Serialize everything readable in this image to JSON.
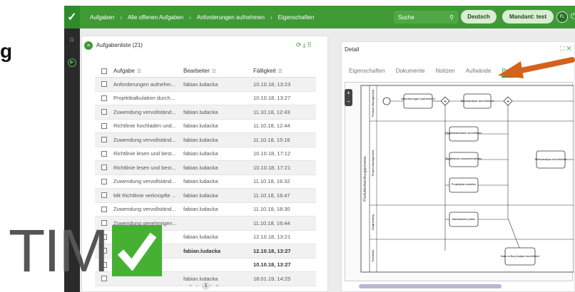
{
  "slide_text": "g",
  "topbar": {
    "breadcrumbs": [
      "Aufgaben",
      "Alle offenen Aufgaben",
      "Anforderungen aufnehmen",
      "Eigenschaften"
    ],
    "search_placeholder": "Suche",
    "language": "Deutsch",
    "mandant": "Mandant: test",
    "avatar_initials": "FL"
  },
  "tasklist": {
    "title": "Aufgabenliste (21)",
    "columns": [
      "Aufgabe",
      "Bearbeiter",
      "Fälligkeit"
    ],
    "rows": [
      {
        "task": "Anforderungen aufnehm...",
        "user": "fabian.ludacka",
        "due": "10.10.18, 13:23",
        "bold": false
      },
      {
        "task": "Projektkalkulation durch...",
        "user": "",
        "due": "10.10.18, 13:27",
        "bold": false
      },
      {
        "task": "Zuwendung vervollständ...",
        "user": "fabian.ludacka",
        "due": "11.10.18, 12:43",
        "bold": false
      },
      {
        "task": "Richtlinie hochladen und...",
        "user": "fabian.ludacka",
        "due": "11.10.18, 12:44",
        "bold": false
      },
      {
        "task": "Zuwendung vervollständ...",
        "user": "fabian.ludacka",
        "due": "11.10.18, 15:16",
        "bold": false
      },
      {
        "task": "Richtlinie lesen und best...",
        "user": "fabian.ludacka",
        "due": "10.10.18, 17:12",
        "bold": false
      },
      {
        "task": "Richtlinie lesen und best...",
        "user": "fabian.ludacka",
        "due": "10.10.18, 17:21",
        "bold": false
      },
      {
        "task": "Zuwendung vervollständ...",
        "user": "fabian.ludacka",
        "due": "11.10.18, 16:32",
        "bold": false
      },
      {
        "task": "Mit Richtlinie verknüpfte ...",
        "user": "fabian.ludacka",
        "due": "11.10.18, 16:47",
        "bold": false
      },
      {
        "task": "Zuwendung vervollständ...",
        "user": "fabian.ludacka",
        "due": "11.10.18, 18:30",
        "bold": false
      },
      {
        "task": "Zuwendung genehmigen...",
        "user": "",
        "due": "11.10.18, 16:44",
        "bold": false
      },
      {
        "task": "",
        "user": "fabian.ludacka",
        "due": "12.10.18, 13:21",
        "bold": false
      },
      {
        "task": "",
        "user": "fabian.ludacka",
        "due": "12.10.18, 13:27",
        "bold": true
      },
      {
        "task": "",
        "user": "",
        "due": "10.10.18, 13:27",
        "bold": true
      },
      {
        "task": "",
        "user": "fabian.ludacka",
        "due": "18.01.19, 14:25",
        "bold": false
      }
    ],
    "pager_current": "1"
  },
  "detail": {
    "title": "Detail",
    "tabs": [
      "Eigenschaften",
      "Dokumente",
      "Notizen",
      "Aufwände",
      "Prozess"
    ],
    "active_tab": 4,
    "pool_label": "Produktentwicklungsprozess",
    "lanes": [
      "Product Management",
      "Project Management",
      "Engineering",
      "Purchase"
    ],
    "tasks": [
      "Anforderungen aufnehmen",
      "Marktanalyse durchführen",
      "Projektkalkulation durchführen",
      "Projektteam zusammenstellen",
      "Projektplan erstellen",
      "Machbarkeit prüfen",
      "Risikoanalyse durchführen",
      "Make or Buy-Analyse durchführen"
    ]
  },
  "logo": {
    "text": "TIM"
  },
  "colors": {
    "brand": "#3f9a36",
    "arrow": "#d4621a"
  }
}
